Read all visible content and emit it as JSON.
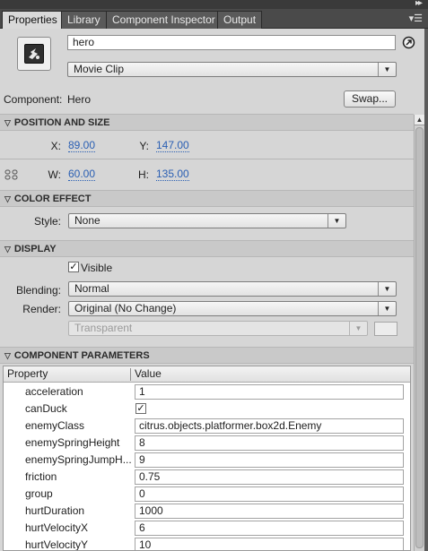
{
  "tabs": [
    {
      "label": "Properties",
      "active": true
    },
    {
      "label": "Library",
      "active": false
    },
    {
      "label": "Component Inspector",
      "active": false
    },
    {
      "label": "Output",
      "active": false
    }
  ],
  "instance": {
    "name_value": "hero",
    "type_selected": "Movie Clip"
  },
  "component": {
    "label": "Component:",
    "value": "Hero",
    "swap_label": "Swap..."
  },
  "position_size": {
    "header": "POSITION AND SIZE",
    "x_label": "X:",
    "x_value": "89.00",
    "y_label": "Y:",
    "y_value": "147.00",
    "w_label": "W:",
    "w_value": "60.00",
    "h_label": "H:",
    "h_value": "135.00"
  },
  "color_effect": {
    "header": "COLOR EFFECT",
    "style_label": "Style:",
    "style_value": "None"
  },
  "display": {
    "header": "DISPLAY",
    "visible_label": "Visible",
    "visible_checked": true,
    "blending_label": "Blending:",
    "blending_value": "Normal",
    "render_label": "Render:",
    "render_value": "Original (No Change)",
    "bg_value": "Transparent"
  },
  "component_params": {
    "header": "COMPONENT PARAMETERS",
    "col_property": "Property",
    "col_value": "Value",
    "rows": [
      {
        "name": "acceleration",
        "value": "1"
      },
      {
        "name": "canDuck",
        "value": "",
        "checkbox": true,
        "checked": true
      },
      {
        "name": "enemyClass",
        "value": "citrus.objects.platformer.box2d.Enemy"
      },
      {
        "name": "enemySpringHeight",
        "value": "8"
      },
      {
        "name": "enemySpringJumpH...",
        "value": "9"
      },
      {
        "name": "friction",
        "value": "0.75"
      },
      {
        "name": "group",
        "value": "0"
      },
      {
        "name": "hurtDuration",
        "value": "1000"
      },
      {
        "name": "hurtVelocityX",
        "value": "6"
      },
      {
        "name": "hurtVelocityY",
        "value": "10"
      }
    ]
  },
  "colors": {
    "panel_bg": "#d6d6d6",
    "tab_bar": "#4a4a4a",
    "link_blue": "#2a5fb3"
  },
  "icons": [
    "movie-clip-symbol-icon",
    "edit-instance-icon",
    "constrain-proportions-icon",
    "panel-menu-icon",
    "collapse-icon"
  ]
}
